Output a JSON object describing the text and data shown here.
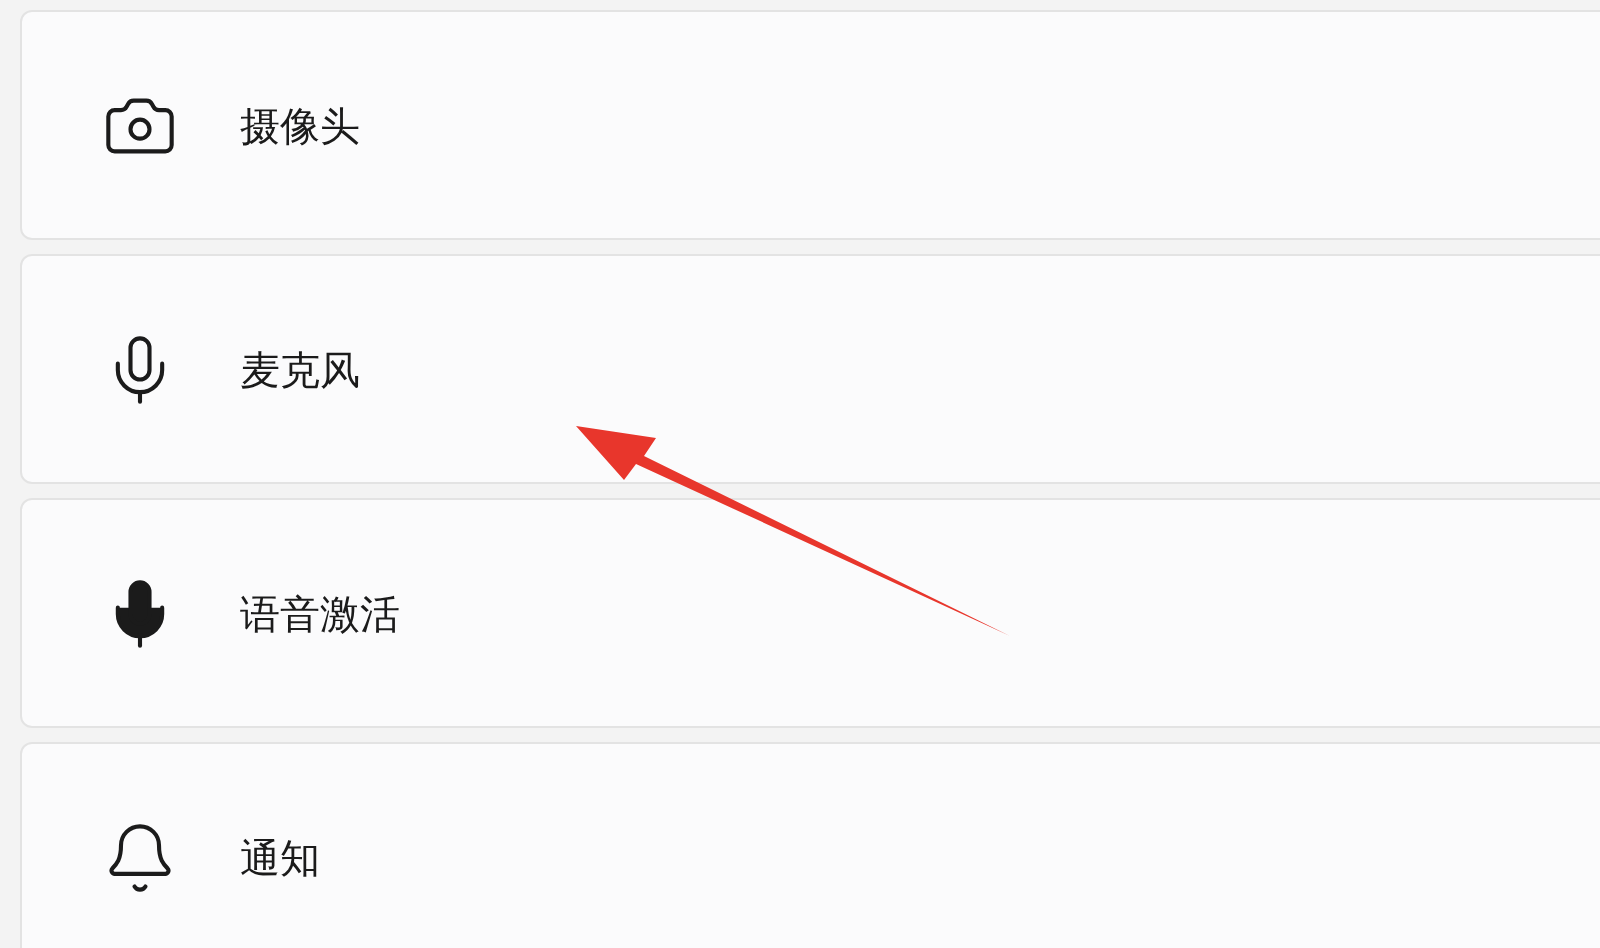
{
  "settings_items": [
    {
      "label": "摄像头"
    },
    {
      "label": "麦克风"
    },
    {
      "label": "语音激活"
    },
    {
      "label": "通知"
    }
  ]
}
